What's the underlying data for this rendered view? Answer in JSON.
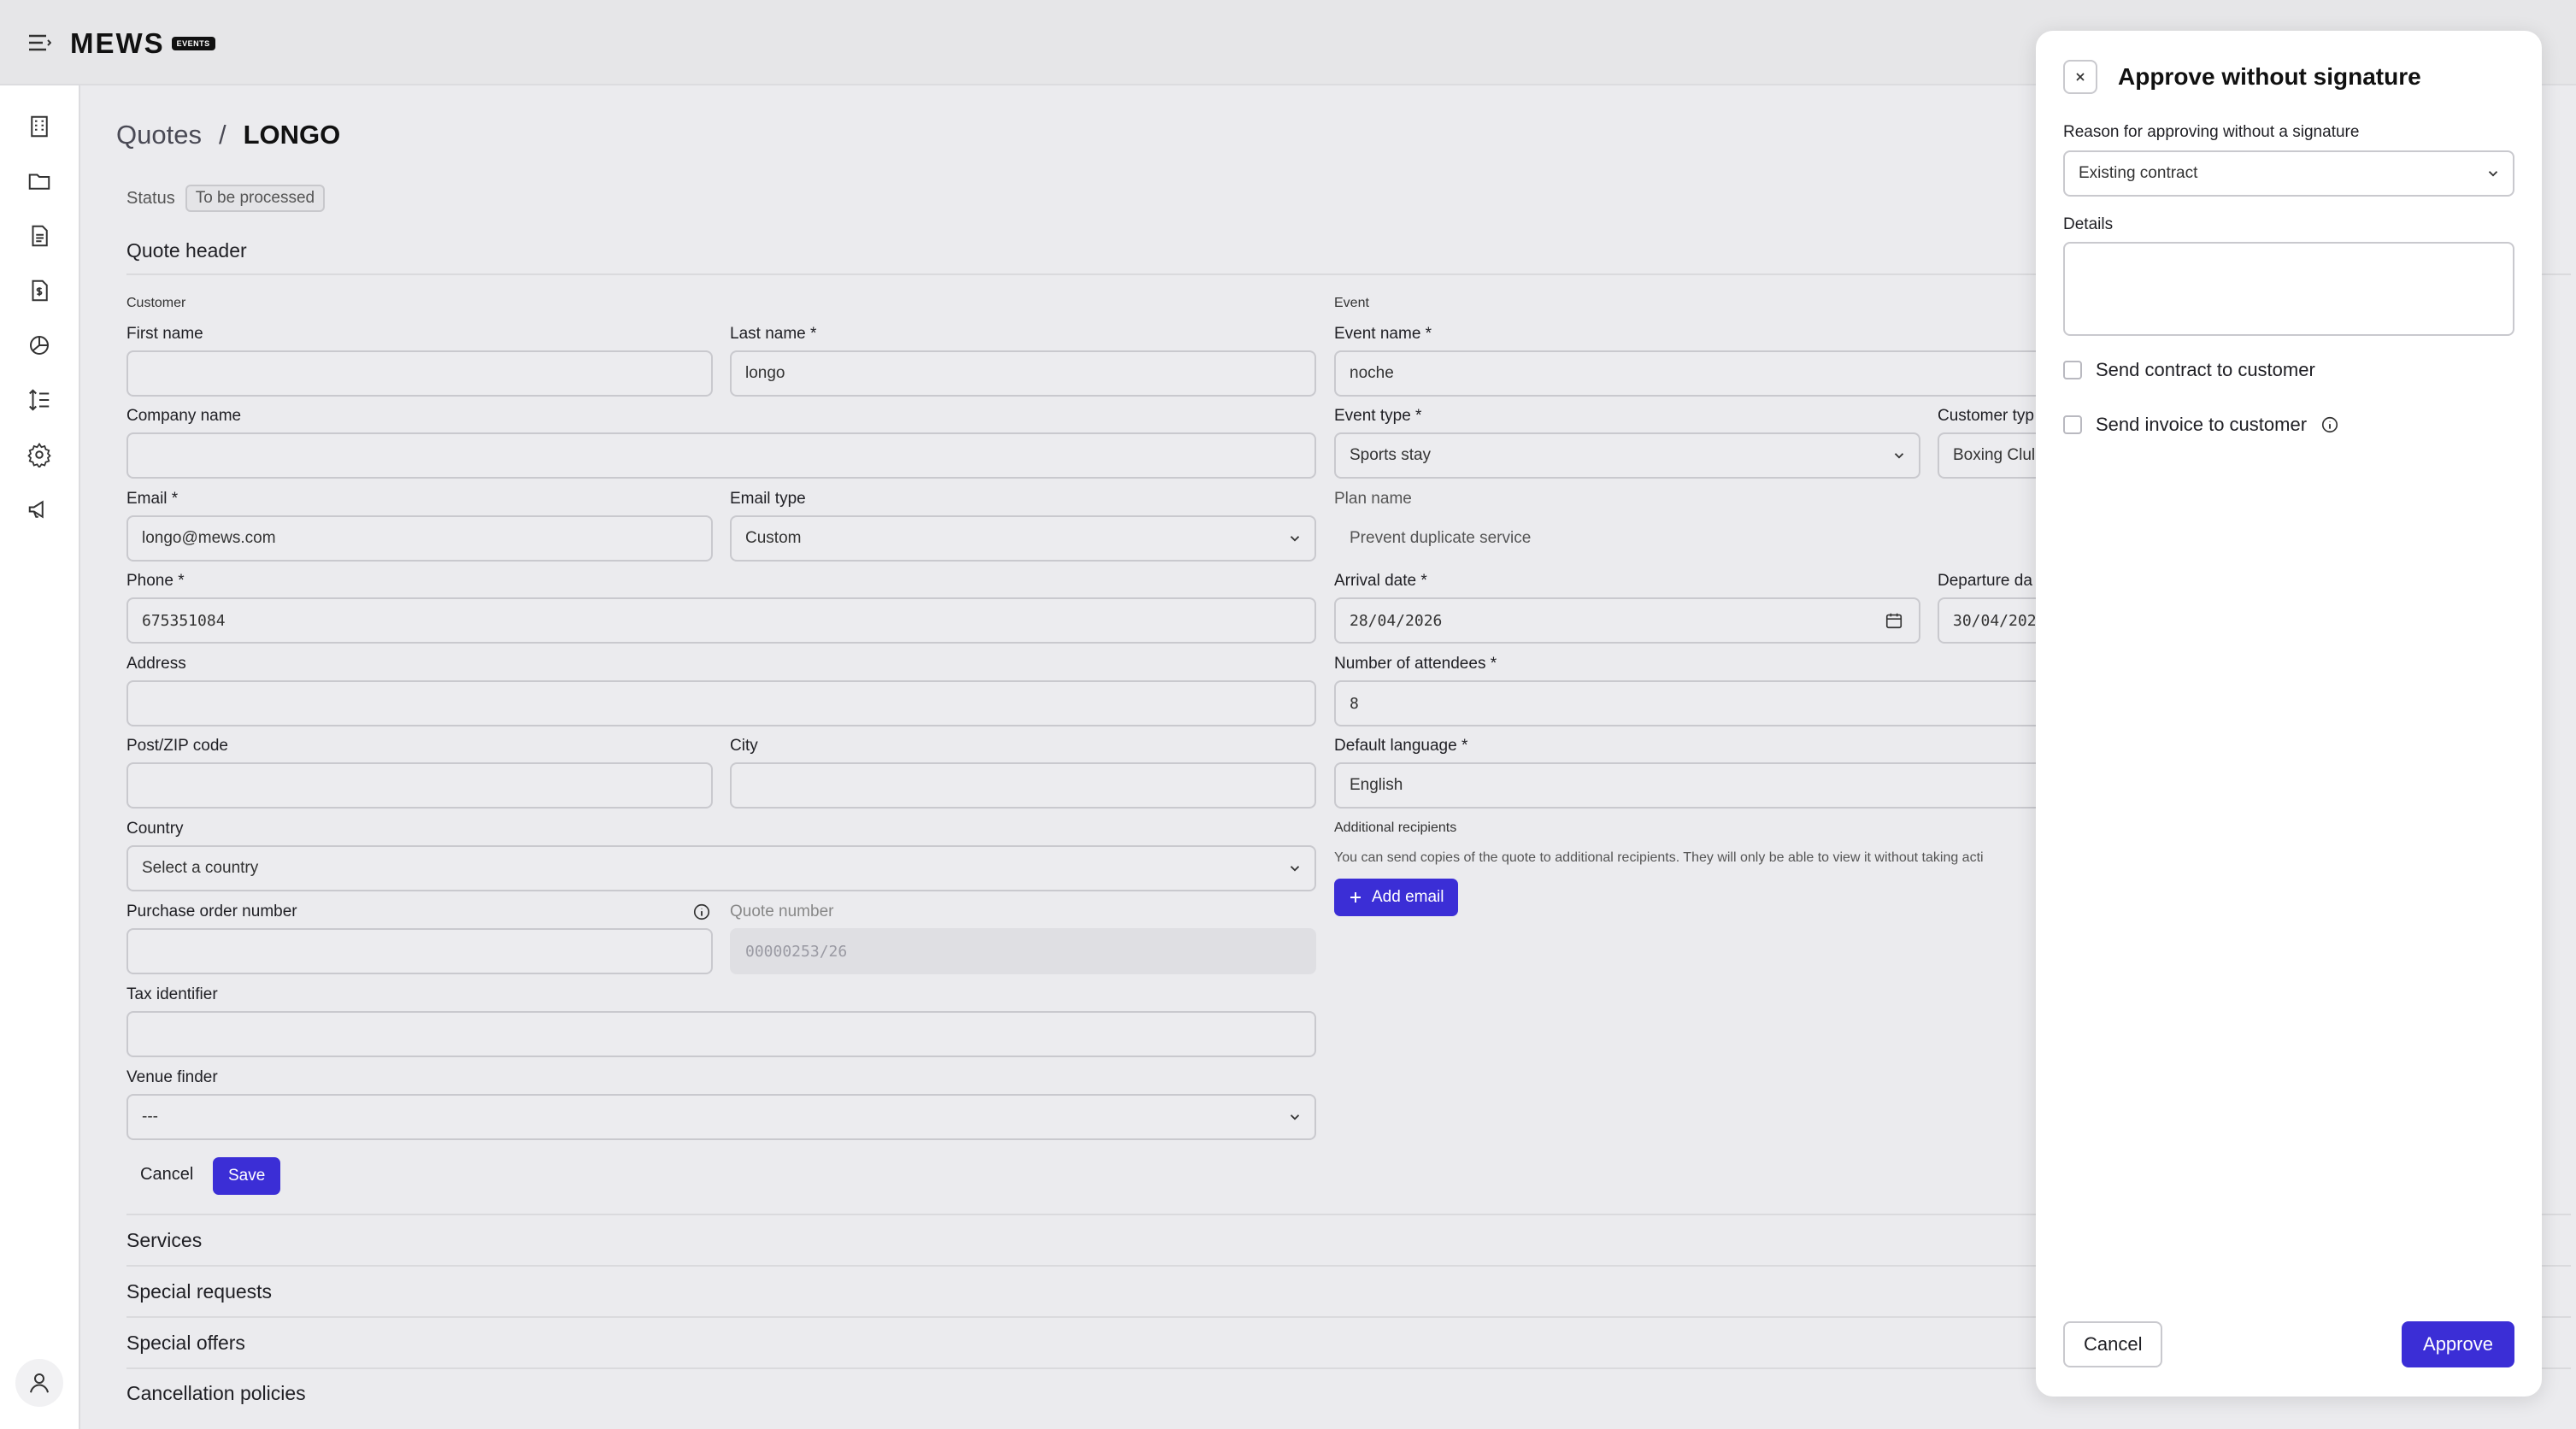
{
  "app": {
    "logo_text": "MEWS",
    "logo_badge": "EVENTS"
  },
  "sidebar": {
    "icons": [
      "building-icon",
      "folder-icon",
      "document-list-icon",
      "invoice-icon",
      "pie-chart-icon",
      "sort-icon",
      "gear-icon",
      "megaphone-icon"
    ],
    "avatar": "user-icon"
  },
  "breadcrumb": {
    "parent": "Quotes",
    "separator": "/",
    "current": "LONGO"
  },
  "status": {
    "label": "Status",
    "value": "To be processed"
  },
  "quote_header": {
    "title": "Quote header",
    "customer_section": "Customer",
    "event_section": "Event",
    "first_name": {
      "label": "First name",
      "value": ""
    },
    "last_name": {
      "label": "Last name *",
      "value": "longo"
    },
    "company_name": {
      "label": "Company name",
      "value": ""
    },
    "email": {
      "label": "Email *",
      "value": "longo@mews.com"
    },
    "email_type": {
      "label": "Email type",
      "value": "Custom"
    },
    "phone": {
      "label": "Phone *",
      "value": "675351084"
    },
    "address": {
      "label": "Address",
      "value": ""
    },
    "postcode": {
      "label": "Post/ZIP code",
      "value": ""
    },
    "city": {
      "label": "City",
      "value": ""
    },
    "country": {
      "label": "Country",
      "value": "Select a country"
    },
    "purchase_order": {
      "label": "Purchase order number",
      "value": ""
    },
    "quote_number": {
      "label": "Quote number",
      "value": "00000253/26"
    },
    "tax_identifier": {
      "label": "Tax identifier",
      "value": ""
    },
    "venue_finder": {
      "label": "Venue finder",
      "value": "---"
    },
    "event_name": {
      "label": "Event name *",
      "value": "noche"
    },
    "event_type": {
      "label": "Event type *",
      "value": "Sports stay"
    },
    "customer_type": {
      "label": "Customer typ",
      "value": "Boxing Clul"
    },
    "plan_name": {
      "label": "Plan name",
      "value": "Prevent duplicate service"
    },
    "arrival_date": {
      "label": "Arrival date *",
      "value": "28/04/2026"
    },
    "departure_date": {
      "label": "Departure da",
      "value": "30/04/202"
    },
    "attendees": {
      "label": "Number of attendees *",
      "value": "8"
    },
    "default_language": {
      "label": "Default language *",
      "value": "English"
    },
    "additional_recipients": {
      "label": "Additional recipients",
      "helper": "You can send copies of the quote to additional recipients. They will only be able to view it without taking acti",
      "add_email": "Add email"
    },
    "cancel": "Cancel",
    "save": "Save"
  },
  "sections": [
    "Services",
    "Special requests",
    "Special offers",
    "Cancellation policies"
  ],
  "drawer": {
    "title": "Approve without signature",
    "reason_label": "Reason for approving without a signature",
    "reason_value": "Existing contract",
    "details_label": "Details",
    "details_value": "",
    "send_contract": "Send contract to customer",
    "send_invoice": "Send invoice to customer",
    "cancel": "Cancel",
    "approve": "Approve"
  },
  "colors": {
    "accent": "#3b2ed6",
    "background": "#ebebee"
  }
}
